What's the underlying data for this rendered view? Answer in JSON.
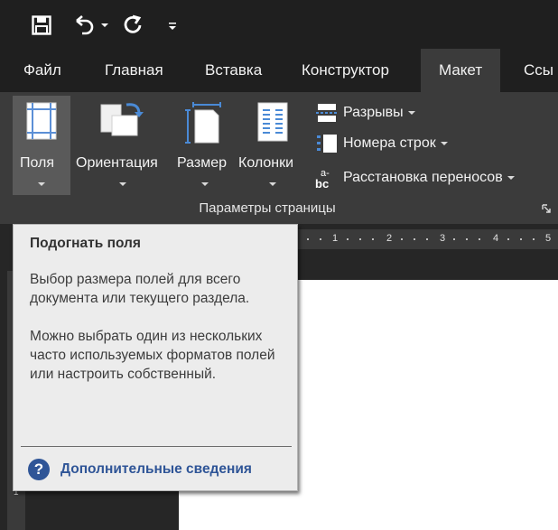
{
  "quick_access": {
    "icons": [
      "save-icon",
      "undo-icon",
      "redo-icon",
      "customize-qat-icon"
    ]
  },
  "tabs": [
    {
      "label": "Файл"
    },
    {
      "label": "Главная"
    },
    {
      "label": "Вставка"
    },
    {
      "label": "Конструктор"
    },
    {
      "label": "Макет",
      "active": true
    },
    {
      "label": "Ссы"
    }
  ],
  "ribbon": {
    "group_label": "Параметры страницы",
    "big_buttons": [
      {
        "label": "Поля",
        "icon": "margins-icon"
      },
      {
        "label": "Ориентация",
        "icon": "orientation-icon"
      },
      {
        "label": "Размер",
        "icon": "size-icon"
      },
      {
        "label": "Колонки",
        "icon": "columns-icon"
      }
    ],
    "small_buttons": [
      {
        "label": "Разрывы",
        "icon": "breaks-icon"
      },
      {
        "label": "Номера строк",
        "icon": "line-numbers-icon"
      },
      {
        "label": "Расстановка переносов",
        "icon": "hyphenation-icon"
      }
    ]
  },
  "ruler": {
    "marks": [
      "1",
      "2",
      "3",
      "4",
      "5"
    ]
  },
  "vruler": {
    "mark": "1"
  },
  "tooltip": {
    "title": "Подогнать поля",
    "paragraph1": "Выбор размера полей для всего документа или текущего раздела.",
    "paragraph2": "Можно выбрать один из нескольких часто используемых форматов полей или настроить собственный.",
    "more_link": "Дополнительные сведения"
  },
  "colors": {
    "ribbon_bg": "#3b3b3b",
    "titlebar_bg": "#1f1f1f",
    "accent_link": "#2f5597"
  }
}
